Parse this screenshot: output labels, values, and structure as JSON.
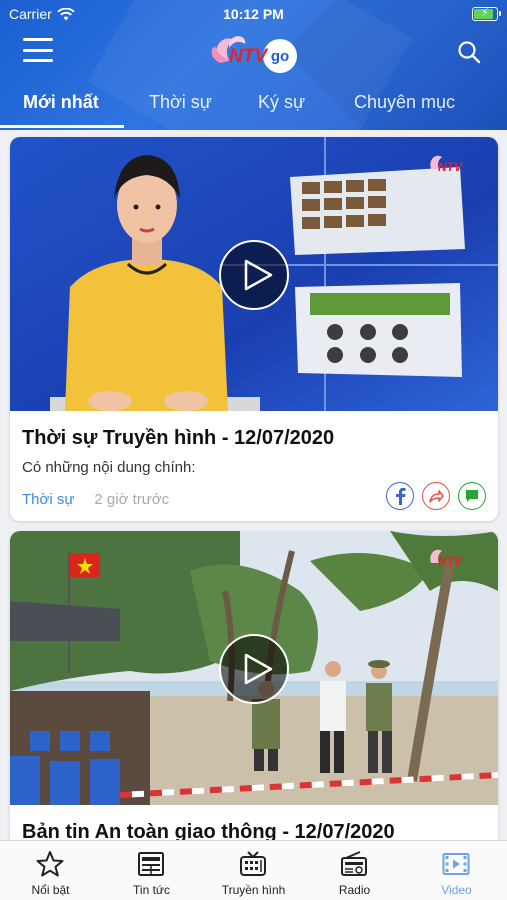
{
  "status": {
    "carrier": "Carrier",
    "time": "10:12 PM"
  },
  "header": {
    "logo_text": "NTV",
    "logo_go": "go"
  },
  "tabs": [
    {
      "label": "Mới nhất",
      "active": true
    },
    {
      "label": "Thời sự",
      "active": false
    },
    {
      "label": "Ký sự",
      "active": false
    },
    {
      "label": "Chuyên mục",
      "active": false
    }
  ],
  "feed": [
    {
      "title": "Thời sự Truyền hình - 12/07/2020",
      "description": "Có những nội dung chính:",
      "category": "Thời sự",
      "time": "2 giờ trước"
    },
    {
      "title": "Bản tin An toàn giao thông - 12/07/2020"
    }
  ],
  "bottom_nav": [
    {
      "label": "Nổi bật",
      "icon": "star-icon"
    },
    {
      "label": "Tin tức",
      "icon": "news-icon"
    },
    {
      "label": "Truyền hình",
      "icon": "tv-icon"
    },
    {
      "label": "Radio",
      "icon": "radio-icon"
    },
    {
      "label": "Video",
      "icon": "video-icon",
      "active": true
    }
  ],
  "colors": {
    "header": "#2a6ad8",
    "accent": "#3d8be0",
    "active_nav": "#6aa3e6"
  }
}
